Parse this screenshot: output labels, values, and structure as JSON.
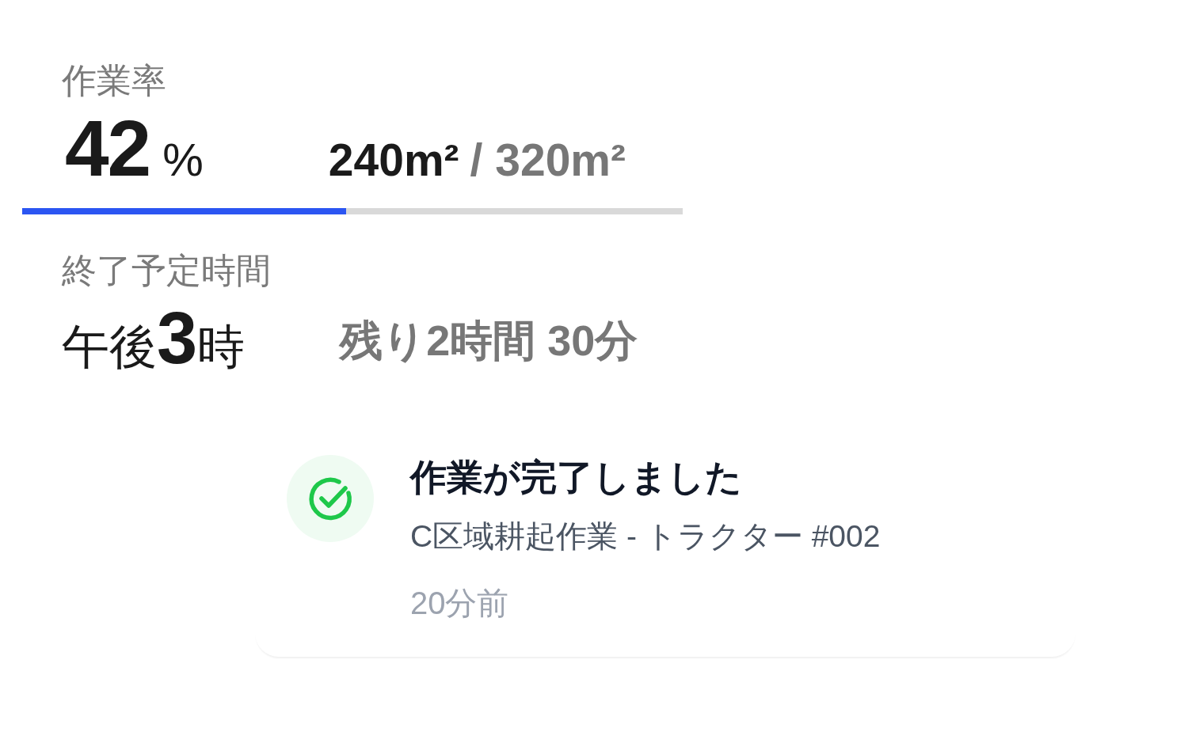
{
  "progress": {
    "label": "作業率",
    "percent": "42",
    "unit": "%",
    "area_done": "240m²",
    "area_total": "/ 320m²",
    "level": 0.49
  },
  "eta": {
    "label": "終了予定時間",
    "time": "午後**3**時",
    "remaining": "残り2時間 30分"
  },
  "notification": {
    "kind": "success",
    "title": "作業が完了しました",
    "detail": "C区域耕起作業 - トラクター #002",
    "time": "20分前"
  }
}
